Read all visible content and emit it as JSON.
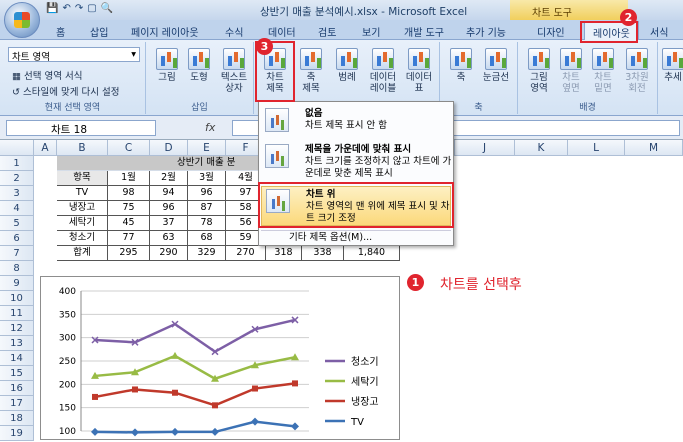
{
  "window": {
    "title": "상반기 매출 분석예시.xlsx - Microsoft Excel",
    "context_tab": "차트 도구"
  },
  "tabs": [
    "홈",
    "삽입",
    "페이지 레이아웃",
    "수식",
    "데이터",
    "검토",
    "보기",
    "개발 도구",
    "추가 기능",
    "디자인",
    "레이아웃",
    "서식"
  ],
  "ribbon": {
    "selection": {
      "combo_value": "차트 영역",
      "format_selection": "선택 영역 서식",
      "reset_style": "스타일에 맞게 다시 설정",
      "group_label": "현재 선택 영역"
    },
    "insert": {
      "picture": "그림",
      "shapes": "도형",
      "textbox_l1": "텍스트",
      "textbox_l2": "상자",
      "group_label": "삽입"
    },
    "labels": {
      "chart_title_l1": "차트",
      "chart_title_l2": "제목",
      "axis_title_l1": "축",
      "axis_title_l2": "제목",
      "legend": "범례",
      "data_labels_l1": "데이터",
      "data_labels_l2": "레이블",
      "data_table_l1": "데이터",
      "data_table_l2": "표"
    },
    "axes": {
      "axes": "축",
      "gridlines": "눈금선",
      "group_label": "축"
    },
    "background": {
      "plot_area_l1": "그림",
      "plot_area_l2": "영역",
      "chart_wall_l1": "차트",
      "chart_wall_l2": "옆면",
      "chart_floor_l1": "차트",
      "chart_floor_l2": "밑면",
      "rotation_l1": "3차원",
      "rotation_l2": "회전",
      "group_label": "배경"
    },
    "trend": "추세"
  },
  "formula_bar": {
    "name_box": "차트 18",
    "fx": "fx"
  },
  "dropdown": {
    "items": [
      {
        "title": "없음",
        "desc": "차트 제목 표시 안 함"
      },
      {
        "title": "제목을 가운데에 맞춰 표시",
        "desc": "차트 크기를 조정하지 않고 차트에 가운데로 맞춘 제목 표시"
      },
      {
        "title": "차트 위",
        "desc": "차트 영역의 맨 위에 제목 표시 및 차트 크기 조정"
      }
    ],
    "more": "기타 제목 옵션(M)..."
  },
  "columns": [
    "A",
    "B",
    "C",
    "D",
    "E",
    "F",
    "G",
    "H",
    "I",
    "J",
    "K",
    "L",
    "M",
    "N"
  ],
  "rows": [
    "1",
    "2",
    "3",
    "4",
    "5",
    "6",
    "7",
    "8",
    "9",
    "10",
    "11",
    "12",
    "13",
    "14",
    "15",
    "16",
    "17",
    "18",
    "19"
  ],
  "sheet": {
    "title": "상반기 매출 분",
    "header": [
      "항목",
      "1월",
      "2월",
      "3월",
      "4월"
    ],
    "data": [
      [
        "TV",
        "98",
        "94",
        "96",
        "97"
      ],
      [
        "냉장고",
        "75",
        "96",
        "87",
        "58"
      ],
      [
        "세탁기",
        "45",
        "37",
        "78",
        "56"
      ],
      [
        "청소기",
        "77",
        "63",
        "68",
        "59"
      ]
    ],
    "total": [
      "합계",
      "295",
      "290",
      "329",
      "270",
      "318",
      "338",
      "1,840"
    ]
  },
  "annotation": {
    "text": "차트를 선택후",
    "badge1": "1",
    "badge2": "2",
    "badge3": "3"
  },
  "chart_data": {
    "type": "line",
    "categories": [
      "1",
      "2",
      "3",
      "4",
      "5",
      "6"
    ],
    "ylim": [
      100,
      400
    ],
    "yticks": [
      "400",
      "350",
      "300",
      "250",
      "200",
      "150",
      "100"
    ],
    "series": [
      {
        "name": "청소기",
        "color": "#7d5fa6",
        "values": [
          295,
          290,
          329,
          270,
          318,
          338
        ]
      },
      {
        "name": "세탁기",
        "color": "#98bb45",
        "values": [
          218,
          226,
          261,
          212,
          241,
          258
        ]
      },
      {
        "name": "냉장고",
        "color": "#c0392b",
        "values": [
          173,
          189,
          182,
          155,
          191,
          202
        ]
      },
      {
        "name": "TV",
        "color": "#3c72b5",
        "values": [
          98,
          97,
          98,
          98,
          120,
          110
        ]
      }
    ]
  }
}
